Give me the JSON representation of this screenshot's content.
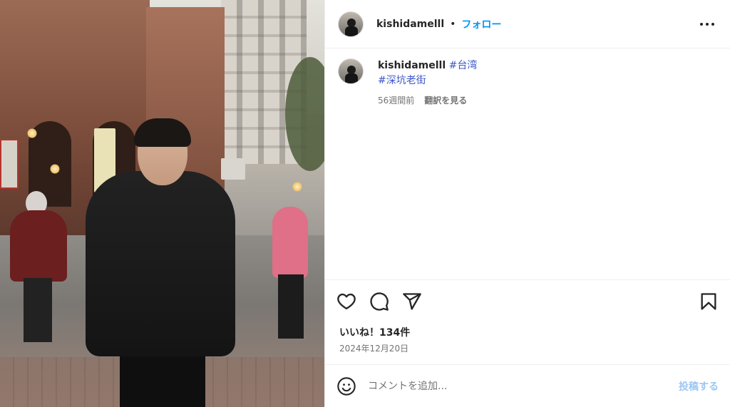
{
  "post": {
    "username": "kishidamelll",
    "dot": "•",
    "follow_label": "フォロー",
    "more_icon": "more-horizontal-icon"
  },
  "caption": {
    "username": "kishidamelll",
    "hashtags": [
      "#台湾",
      "#深坑老街"
    ],
    "time_ago": "56週間前",
    "translate_label": "翻訳を見る"
  },
  "actions": {
    "like_icon": "heart-icon",
    "comment_icon": "comment-icon",
    "share_icon": "send-icon",
    "save_icon": "bookmark-icon"
  },
  "stats": {
    "likes_text": "いいね！134件",
    "date": "2024年12月20日"
  },
  "comment": {
    "placeholder": "コメントを追加...",
    "post_label": "投稿する",
    "emoji_icon": "emoji-icon"
  },
  "colors": {
    "accent": "#0095f6",
    "hashtag": "#3b57c6",
    "post_disabled": "#9ec6f6"
  }
}
